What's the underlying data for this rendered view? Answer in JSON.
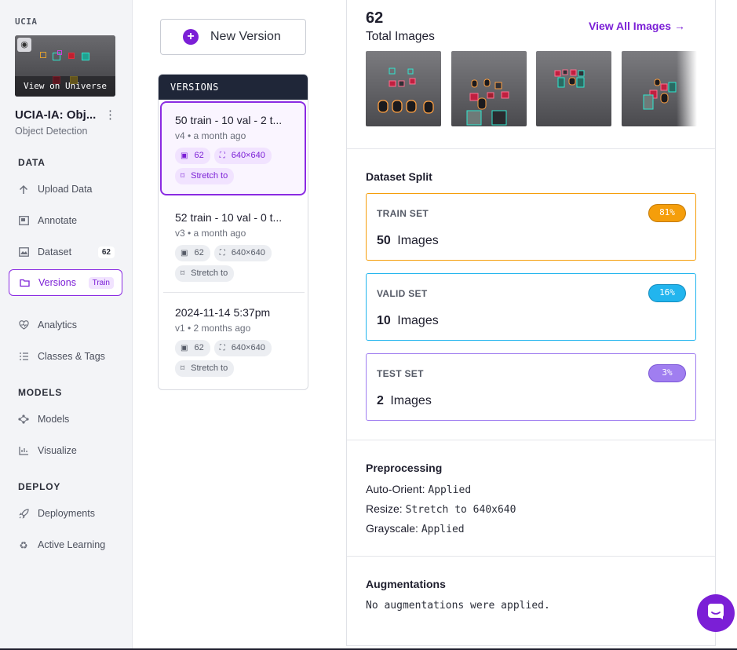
{
  "sidebar": {
    "workspace": "UCIA",
    "view_on_universe": "View on Universe",
    "project_title": "UCIA-IA: Obj...",
    "project_type": "Object Detection",
    "sections": {
      "data": "DATA",
      "models": "MODELS",
      "deploy": "DEPLOY"
    },
    "items": [
      {
        "label": "Upload Data",
        "icon": "upload-icon"
      },
      {
        "label": "Annotate",
        "icon": "annotate-icon"
      },
      {
        "label": "Dataset",
        "icon": "dataset-icon",
        "badge": "62"
      },
      {
        "label": "Versions",
        "icon": "versions-icon",
        "badge": "Train",
        "active": true
      },
      {
        "label": "Analytics",
        "icon": "analytics-icon"
      },
      {
        "label": "Classes & Tags",
        "icon": "list-icon"
      },
      {
        "label": "Models",
        "icon": "models-icon"
      },
      {
        "label": "Visualize",
        "icon": "chart-icon"
      },
      {
        "label": "Deployments",
        "icon": "rocket-icon"
      },
      {
        "label": "Active Learning",
        "icon": "recycle-icon"
      }
    ]
  },
  "versions": {
    "new_version_label": "New Version",
    "header": "VERSIONS",
    "list": [
      {
        "title": "50 train - 10 val - 2 t...",
        "meta": "v4 • a month ago",
        "images": "62",
        "size": "640×640",
        "resize": "Stretch to",
        "active": true
      },
      {
        "title": "52 train - 10 val - 0 t...",
        "meta": "v3 • a month ago",
        "images": "62",
        "size": "640×640",
        "resize": "Stretch to"
      },
      {
        "title": "2024-11-14 5:37pm",
        "meta": "v1 • 2 months ago",
        "images": "62",
        "size": "640×640",
        "resize": "Stretch to"
      }
    ]
  },
  "main": {
    "total_count": "62",
    "total_label": "Total Images",
    "view_all": "View All Images →",
    "split_title": "Dataset Split",
    "splits": [
      {
        "label": "TRAIN SET",
        "count": "50",
        "unit": "Images",
        "pct": "81%",
        "color": "#f59e0b"
      },
      {
        "label": "VALID SET",
        "count": "10",
        "unit": "Images",
        "pct": "16%",
        "color": "#22b5ee"
      },
      {
        "label": "TEST SET",
        "count": "2",
        "unit": "Images",
        "pct": "3%",
        "color": "#a07ef0"
      }
    ],
    "preprocessing_title": "Preprocessing",
    "preprocessing": [
      {
        "key": "Auto-Orient:",
        "value": "Applied"
      },
      {
        "key": "Resize:",
        "value": "Stretch to 640x640"
      },
      {
        "key": "Grayscale:",
        "value": "Applied"
      }
    ],
    "augmentations_title": "Augmentations",
    "augmentations_text": "No augmentations were applied."
  },
  "colors": {
    "accent": "#7b1fd6",
    "header_dark": "#1f2638"
  }
}
